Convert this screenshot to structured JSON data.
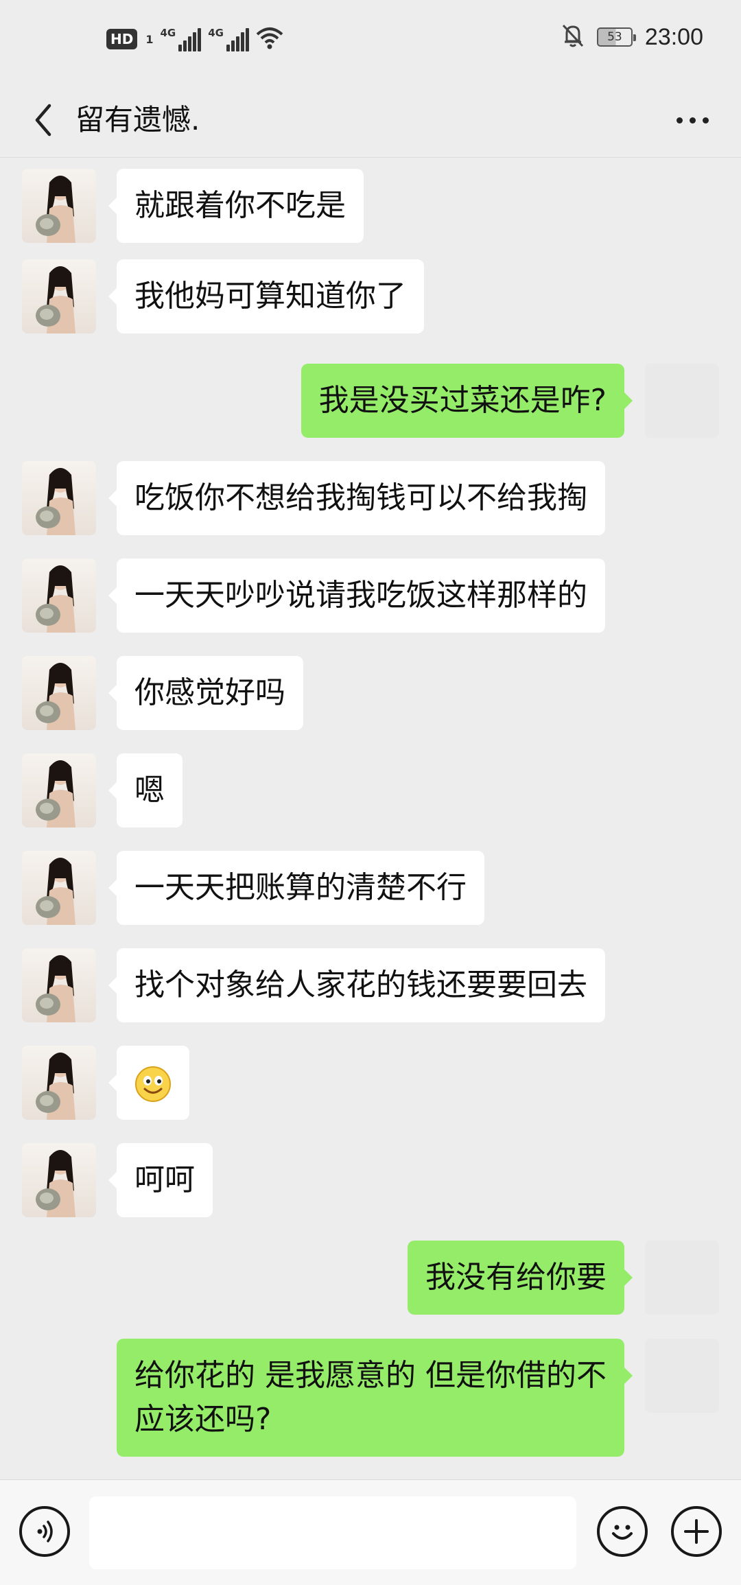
{
  "status_bar": {
    "hd_label": "HD",
    "hd_sub": "1",
    "sim1_label": "4G",
    "sim2_label": "4G",
    "battery": "53",
    "time": "23:00",
    "icons": [
      "hd-icon",
      "signal-icon",
      "signal-icon",
      "wifi-icon",
      "mute-bell-icon",
      "battery-icon"
    ]
  },
  "header": {
    "title": "留有遗憾.",
    "back_icon": "back-arrow-icon",
    "more_icon": "more-dots-icon"
  },
  "messages": [
    {
      "side": "left",
      "text": "就跟着你不吃是"
    },
    {
      "side": "left",
      "text": "我他妈可算知道你了"
    },
    {
      "side": "right",
      "text": "我是没买过菜还是咋?"
    },
    {
      "side": "left",
      "text": "吃饭你不想给我掏钱可以不给我掏"
    },
    {
      "side": "left",
      "text": "一天天吵吵说请我吃饭这样那样的"
    },
    {
      "side": "left",
      "text": "你感觉好吗"
    },
    {
      "side": "left",
      "text": "嗯"
    },
    {
      "side": "left",
      "text": "一天天把账算的清楚不行"
    },
    {
      "side": "left",
      "text": "找个对象给人家花的钱还要要回去"
    },
    {
      "side": "left",
      "text": "",
      "emoji": "smile-emoji-icon"
    },
    {
      "side": "left",
      "text": "呵呵"
    },
    {
      "side": "right",
      "text": "我没有给你要"
    },
    {
      "side": "right",
      "text": "给你花的 是我愿意的   但是你借的不应该还吗?"
    }
  ],
  "input_bar": {
    "placeholder": "",
    "voice_icon": "voice-icon",
    "emoji_icon": "emoji-icon",
    "plus_icon": "plus-icon"
  },
  "colors": {
    "background": "#ededed",
    "bubble_self": "#95ec69",
    "bubble_other": "#ffffff",
    "input_bar": "#f7f7f7"
  }
}
